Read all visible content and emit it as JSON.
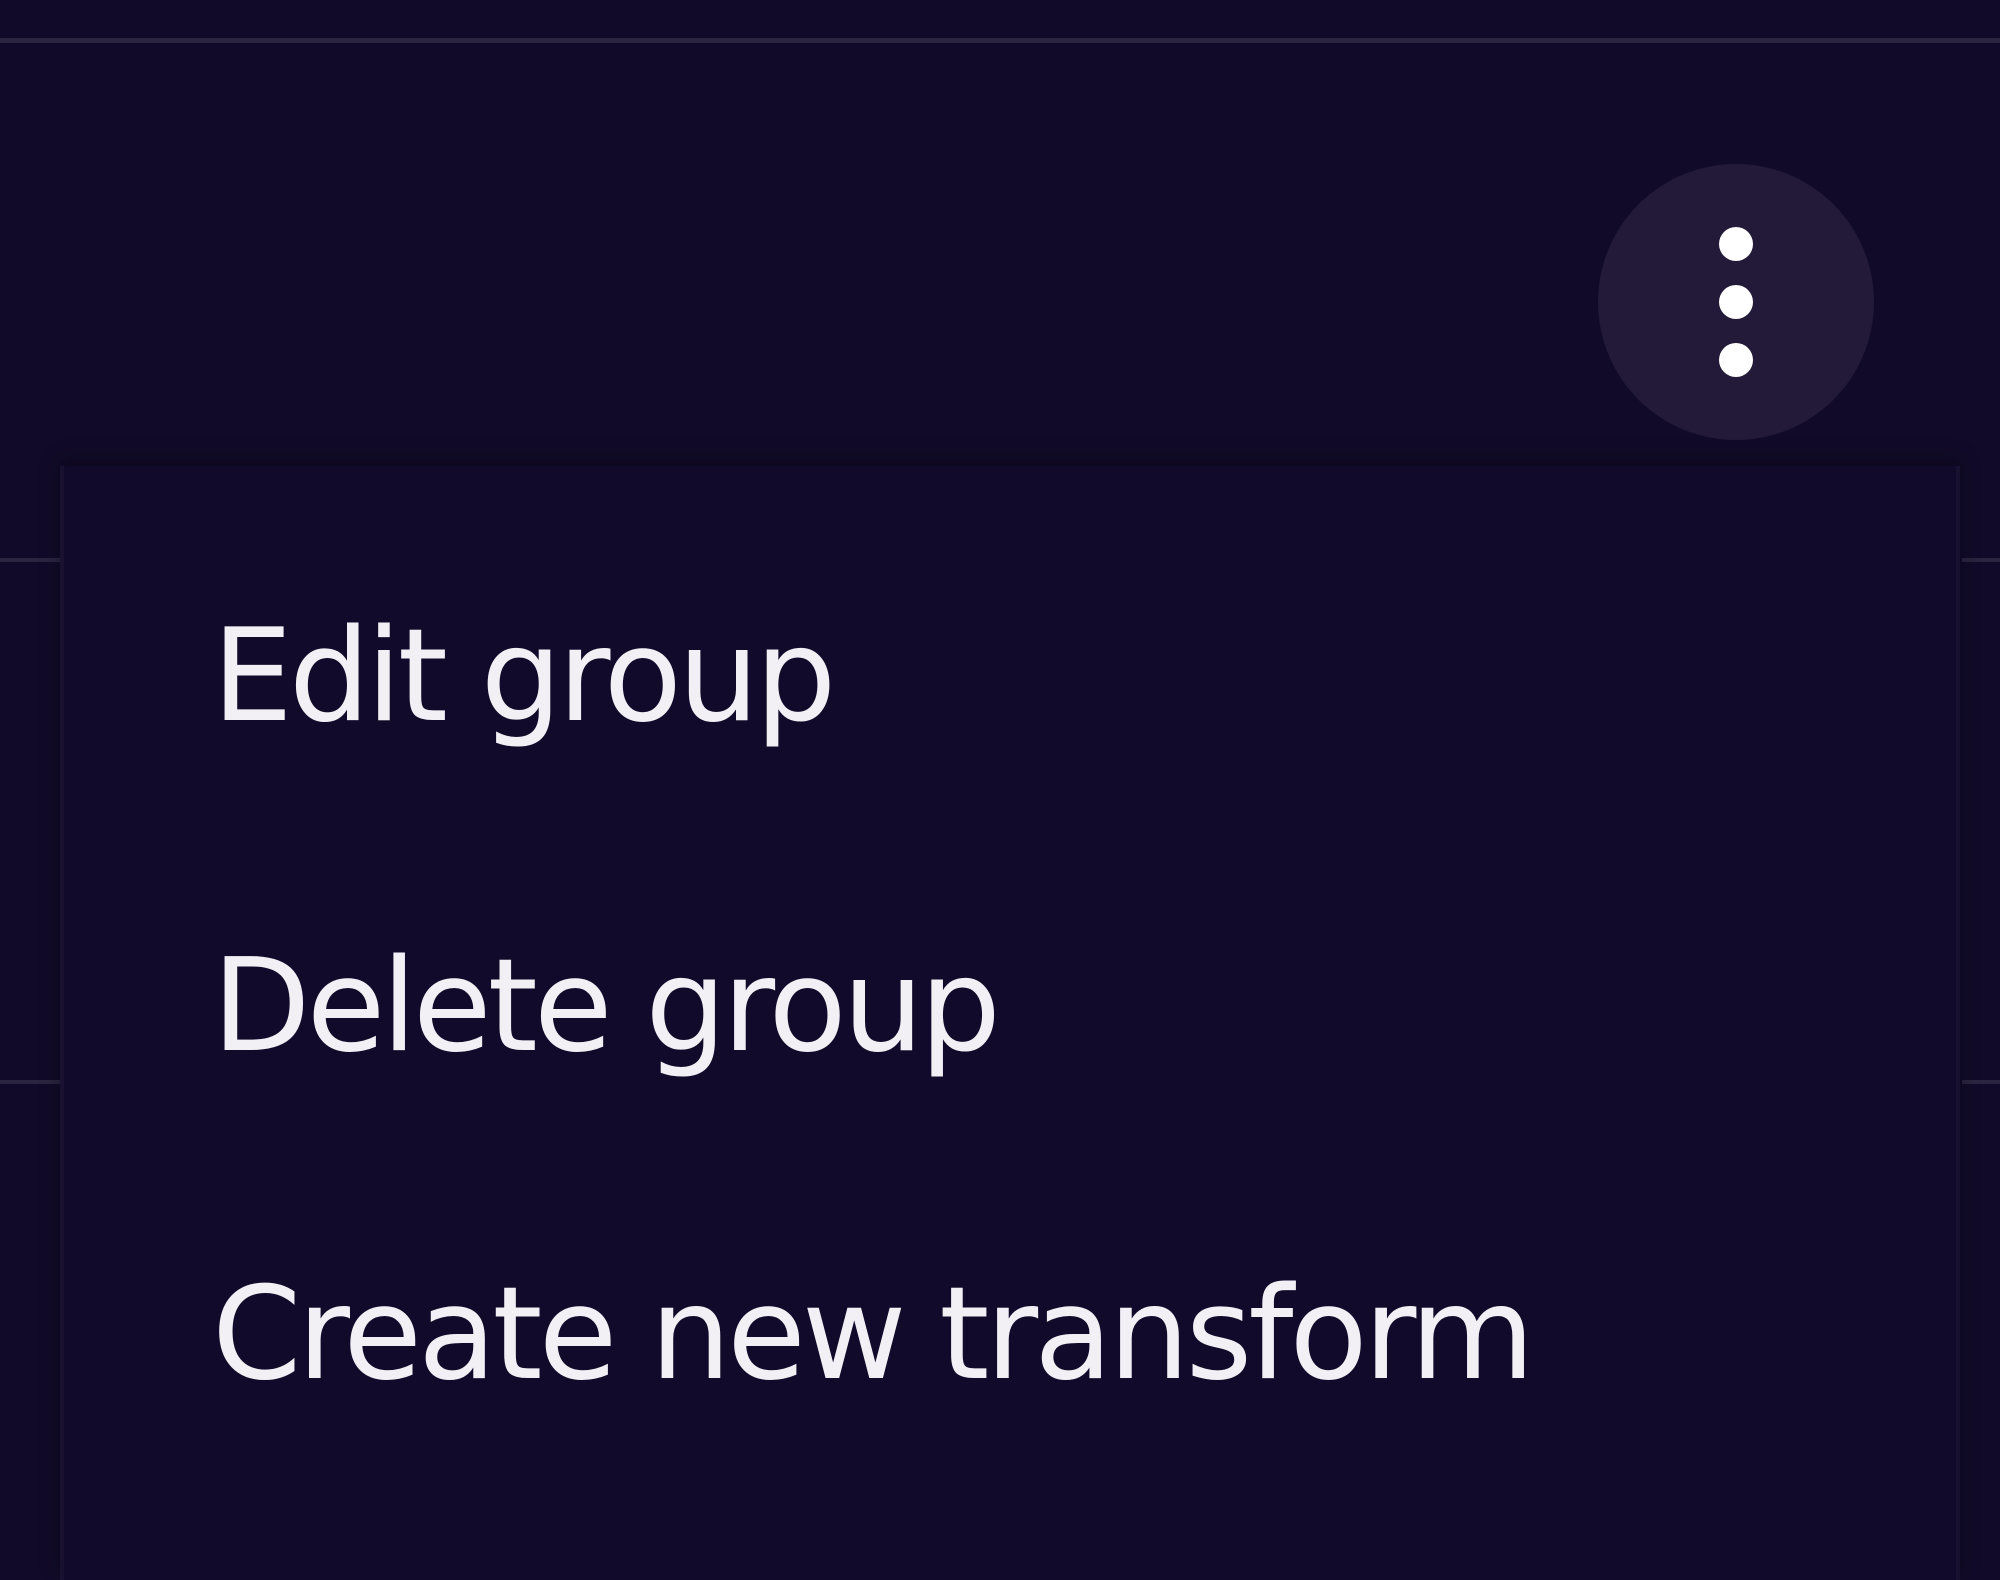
{
  "colors": {
    "background": "#110b29",
    "menu_background": "#120a2a",
    "button_background": "#221a38",
    "divider": "#2a2440",
    "text": "#f2f0f5",
    "icon": "#ffffff"
  },
  "more_button": {
    "icon": "more-vertical-icon"
  },
  "menu": {
    "items": [
      {
        "label": "Edit group"
      },
      {
        "label": "Delete group"
      },
      {
        "label": "Create new transform"
      }
    ]
  }
}
